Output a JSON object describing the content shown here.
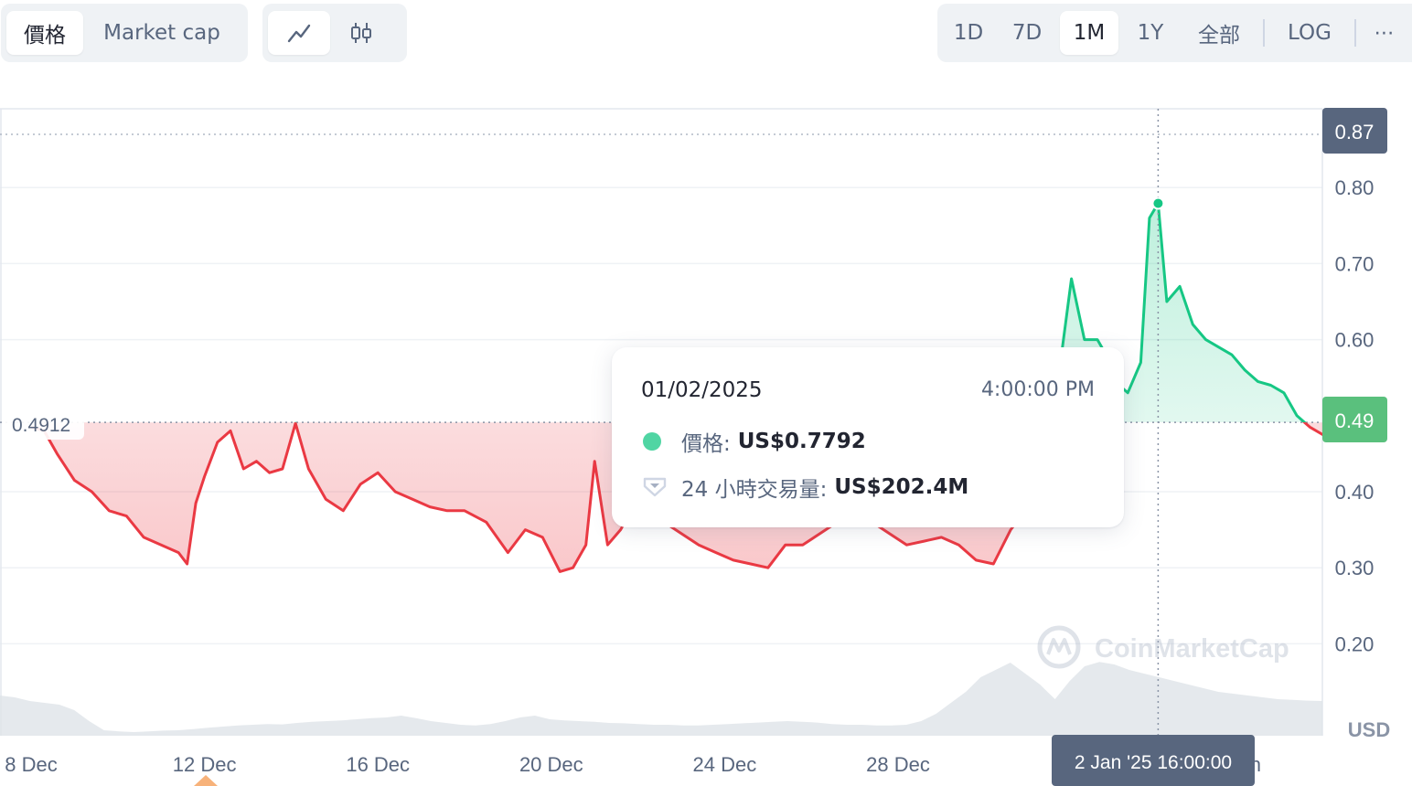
{
  "toolbar": {
    "type_tabs": [
      {
        "label": "價格",
        "active": true
      },
      {
        "label": "Market cap",
        "active": false
      }
    ],
    "style_tabs": [
      {
        "icon": "line-chart-icon",
        "active": true
      },
      {
        "icon": "candlestick-icon",
        "active": false
      }
    ],
    "range_tabs": [
      {
        "label": "1D",
        "active": false
      },
      {
        "label": "7D",
        "active": false
      },
      {
        "label": "1M",
        "active": true
      },
      {
        "label": "1Y",
        "active": false
      },
      {
        "label": "全部",
        "active": false
      }
    ],
    "log_label": "LOG",
    "more_icon": "more-horizontal-icon"
  },
  "tooltip": {
    "date": "01/02/2025",
    "time": "4:00:00 PM",
    "price_label": "價格:",
    "price_value": "US$0.7792",
    "volume_label": "24 小時交易量:",
    "volume_value": "US$202.4M"
  },
  "crosshair_label": "2 Jan '25 16:00:00",
  "watermark": "CoinMarketCap",
  "colors": {
    "up": "#16c784",
    "down": "#ea3943",
    "grid": "#eff2f5",
    "axis_text": "#58667e",
    "badge_gray": "#58667e"
  },
  "chart_data": {
    "type": "area",
    "currency": "USD",
    "reference_price": 0.4912,
    "reference_label": "0.4912",
    "current_price_label": "0.49",
    "max_price_label": "0.87",
    "y_ticks": [
      "0.20",
      "0.30",
      "0.40",
      "0.60",
      "0.70",
      "0.80"
    ],
    "y_tick_values": [
      0.2,
      0.3,
      0.4,
      0.6,
      0.7,
      0.8
    ],
    "ylim": [
      0.1,
      0.88
    ],
    "x_tick_labels": [
      "8 Dec",
      "12 Dec",
      "16 Dec",
      "20 Dec",
      "24 Dec",
      "28 Dec",
      "Jan"
    ],
    "x_tick_days": [
      8,
      12,
      16,
      20,
      24,
      28,
      36
    ],
    "x_range_days": [
      8,
      38.2
    ],
    "volume_max_usd_m": 250,
    "series": [
      {
        "x_days": [
          8.0,
          8.3,
          8.6,
          9.0,
          9.4,
          9.8,
          10.2,
          10.6,
          11.0,
          11.4,
          11.6,
          11.8,
          12.0,
          12.3,
          12.6,
          12.9,
          13.2,
          13.5,
          13.8,
          14.1,
          14.4,
          14.8,
          15.2,
          15.6,
          16.0,
          16.4,
          16.8,
          17.2,
          17.6,
          18.0,
          18.5,
          19.0,
          19.4,
          19.8,
          20.2,
          20.5,
          20.8,
          21.0,
          21.3,
          21.6,
          21.9,
          22.2,
          22.6,
          23.0,
          23.4,
          23.8,
          24.2,
          24.6,
          25.0,
          25.4,
          25.8,
          26.2,
          26.6,
          27.0,
          27.4,
          27.8,
          28.2,
          28.6,
          29.0,
          29.4,
          29.8,
          30.2,
          30.6,
          31.0,
          31.4,
          31.7,
          32.0,
          32.3,
          32.6,
          32.8,
          33.0,
          33.3,
          33.6,
          33.8,
          34.0,
          34.2,
          34.5,
          34.8,
          35.1,
          35.4,
          35.7,
          36.0,
          36.3,
          36.6,
          36.9,
          37.2,
          37.5,
          37.8,
          38.0,
          38.2
        ],
        "price": [
          0.485,
          0.48,
          0.45,
          0.415,
          0.4,
          0.375,
          0.368,
          0.34,
          0.33,
          0.32,
          0.305,
          0.385,
          0.42,
          0.465,
          0.48,
          0.43,
          0.44,
          0.425,
          0.43,
          0.49,
          0.43,
          0.39,
          0.375,
          0.41,
          0.425,
          0.4,
          0.39,
          0.38,
          0.375,
          0.375,
          0.36,
          0.32,
          0.35,
          0.34,
          0.295,
          0.3,
          0.33,
          0.44,
          0.33,
          0.35,
          0.38,
          0.42,
          0.36,
          0.345,
          0.33,
          0.32,
          0.31,
          0.305,
          0.3,
          0.33,
          0.33,
          0.345,
          0.36,
          0.37,
          0.36,
          0.345,
          0.33,
          0.335,
          0.34,
          0.33,
          0.31,
          0.305,
          0.35,
          0.38,
          0.4,
          0.55,
          0.68,
          0.6,
          0.6,
          0.58,
          0.545,
          0.53,
          0.57,
          0.76,
          0.7792,
          0.65,
          0.67,
          0.62,
          0.6,
          0.59,
          0.58,
          0.56,
          0.545,
          0.54,
          0.53,
          0.5,
          0.485,
          0.475,
          0.48,
          0.49
        ]
      }
    ],
    "volume_usd_m": [
      110,
      105,
      95,
      90,
      85,
      70,
      40,
      15,
      12,
      10,
      12,
      14,
      15,
      18,
      22,
      25,
      28,
      30,
      32,
      31,
      35,
      38,
      40,
      42,
      45,
      48,
      50,
      55,
      48,
      40,
      35,
      30,
      28,
      32,
      40,
      50,
      55,
      45,
      42,
      40,
      38,
      35,
      34,
      32,
      30,
      30,
      28,
      28,
      30,
      32,
      34,
      36,
      38,
      40,
      38,
      36,
      32,
      30,
      30,
      28,
      28,
      30,
      40,
      60,
      90,
      120,
      160,
      180,
      200,
      170,
      140,
      100,
      150,
      190,
      202,
      195,
      180,
      170,
      160,
      150,
      140,
      130,
      120,
      115,
      110,
      105,
      100,
      98,
      96,
      95
    ]
  }
}
